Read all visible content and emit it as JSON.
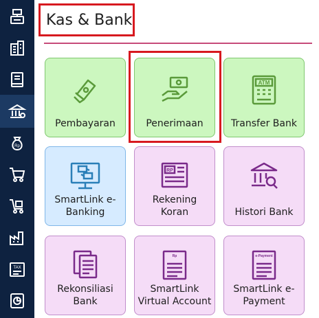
{
  "page_title": "Kas & Bank",
  "sidebar": {
    "items": [
      {
        "icon": "cash-register-icon"
      },
      {
        "icon": "building-icon"
      },
      {
        "icon": "book-icon"
      },
      {
        "icon": "bank-icon",
        "active": true
      },
      {
        "icon": "money-bag-icon"
      },
      {
        "icon": "cart-icon"
      },
      {
        "icon": "cart-box-icon"
      },
      {
        "icon": "factory-icon"
      },
      {
        "icon": "tax-icon"
      },
      {
        "icon": "report-chart-icon"
      }
    ]
  },
  "tiles": [
    {
      "label": "Pembayaran",
      "icon": "money-hand-icon",
      "color": "green"
    },
    {
      "label": "Penerimaan",
      "icon": "receive-money-icon",
      "color": "green",
      "highlighted": true
    },
    {
      "label": "Transfer Bank",
      "icon": "atm-icon",
      "color": "green"
    },
    {
      "label": "SmartLink e-Banking",
      "icon": "e-banking-monitor-icon",
      "color": "blue"
    },
    {
      "label": "Rekening Koran",
      "icon": "bank-statement-icon",
      "color": "purple"
    },
    {
      "label": "Histori Bank",
      "icon": "bank-history-icon",
      "color": "purple"
    },
    {
      "label": "Rekonsiliasi Bank",
      "icon": "reconcile-document-icon",
      "color": "purple"
    },
    {
      "label": "SmartLink Virtual Account",
      "icon": "virtual-account-icon",
      "color": "purple",
      "icon_text": "Virtual Account"
    },
    {
      "label": "SmartLink e-Payment",
      "icon": "e-payment-icon",
      "color": "purple",
      "icon_text": "e-Payment"
    }
  ],
  "icon_texts": {
    "rp": "Rp",
    "rp_upper": "RP",
    "atm": "ATM",
    "tax": "TAX"
  },
  "colors": {
    "sidebar_bg": "#0e2240",
    "green_icon": "#5a9a3a",
    "blue_icon": "#2a7fb8",
    "purple_icon": "#7a2a8a",
    "highlight": "#d7191f"
  }
}
